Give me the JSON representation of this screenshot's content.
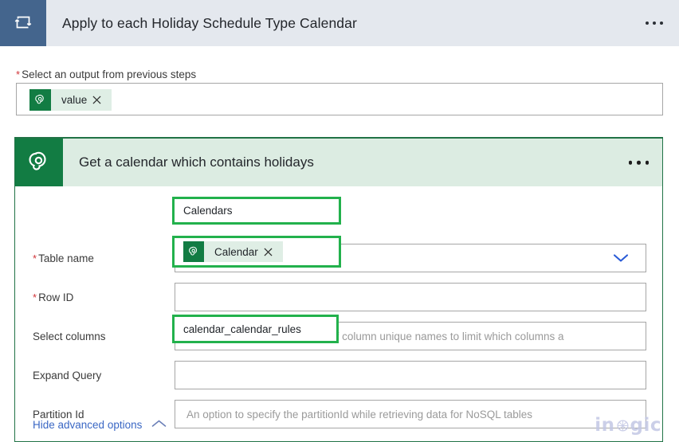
{
  "header": {
    "title": "Apply to each Holiday Schedule Type Calendar",
    "icon": "loop-repeat-icon",
    "menu_icon": "ellipsis-icon",
    "bg_color": "#e4e8ee",
    "icon_bg_color": "#44658d"
  },
  "foreach": {
    "label": "Select an output from previous steps",
    "required": true,
    "required_marker": "*",
    "token": {
      "text": "value",
      "icon": "dataverse-icon",
      "remove_icon": "×"
    }
  },
  "action_card": {
    "title": "Get a calendar which contains holidays",
    "icon": "dataverse-icon",
    "menu_icon": "ellipsis-icon",
    "accent_color": "#217346",
    "icon_bg_color": "#127c43",
    "header_bg_color": "#dcece2",
    "fields": [
      {
        "label": "Table name",
        "required": true,
        "required_marker": "*",
        "type": "dropdown",
        "value": "Calendars",
        "placeholder": "",
        "highlighted": true,
        "chevron_icon": "chevron-down-icon"
      },
      {
        "label": "Row ID",
        "required": true,
        "required_marker": "*",
        "type": "token",
        "value": "Calendar",
        "placeholder": "",
        "highlighted": true,
        "token_icon": "dataverse-icon",
        "remove_icon": "×"
      },
      {
        "label": "Select columns",
        "required": false,
        "required_marker": "",
        "type": "text",
        "value": "",
        "placeholder": "Enter a comma-separated list of column unique names to limit which columns a",
        "highlighted": false
      },
      {
        "label": "Expand Query",
        "required": false,
        "required_marker": "",
        "type": "text",
        "value": "calendar_calendar_rules",
        "placeholder": "",
        "highlighted": true
      },
      {
        "label": "Partition Id",
        "required": false,
        "required_marker": "",
        "type": "text",
        "value": "",
        "placeholder": "An option to specify the partitionId while retrieving data for NoSQL tables",
        "highlighted": false
      }
    ],
    "advanced_options_link": {
      "label": "Hide advanced options",
      "chevron_icon": "chevron-up-icon"
    }
  },
  "watermark": {
    "text_before": "in",
    "text_after": "gic",
    "full_text": "inogic",
    "color": "#c3c7e4"
  },
  "annotation": {
    "color": "#22b14c",
    "description": "green highlight rectangles"
  }
}
